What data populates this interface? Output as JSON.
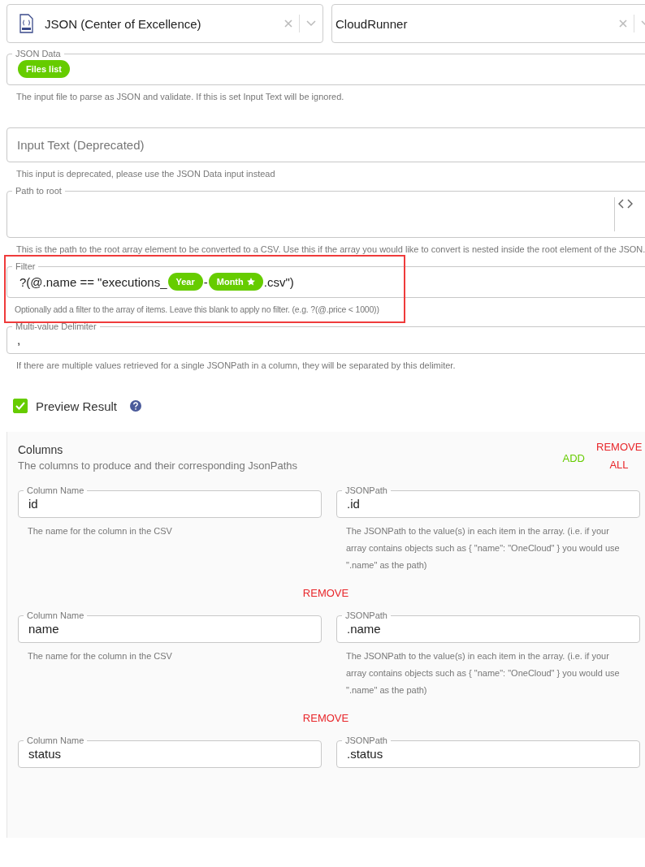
{
  "selects": [
    {
      "value": "JSON (Center of Excellence)"
    },
    {
      "value": "CloudRunner"
    }
  ],
  "fields": [
    {
      "kind": "chips",
      "label": "JSON Data",
      "chips": [
        "Files list"
      ],
      "helper": "The input file to parse as JSON and validate. If this is set Input Text will be ignored."
    },
    {
      "kind": "plain",
      "placeholder": "Input Text (Deprecated)",
      "helper": "This input is deprecated, please use the JSON Data input instead"
    },
    {
      "kind": "code",
      "label": "Path to root",
      "helper": "This is the path to the root array element to be converted to a CSV. Use this if the array you would like to convert is nested inside the root element of the JSON."
    },
    {
      "kind": "mixed",
      "label": "Filter",
      "highlighted": true,
      "parts": [
        {
          "kind": "text",
          "text": "?(@.name == \"executions_"
        },
        {
          "kind": "chip",
          "text": "Year"
        },
        {
          "kind": "text",
          "text": "-"
        },
        {
          "kind": "chip",
          "text": "Month",
          "starred": true
        },
        {
          "kind": "text",
          "text": ".csv\")"
        }
      ],
      "helper": "Optionally add a filter to the array of items. Leave this blank to apply no filter. (e.g. ?(@.price < 1000))"
    },
    {
      "kind": "value",
      "label": "Multi-value Delimiter",
      "value": ",",
      "helper": "If there are multiple values retrieved for a single JSONPath in a column, they will be separated by this delimiter."
    }
  ],
  "preview": {
    "label": "Preview Result",
    "checked": true
  },
  "columns": {
    "title": "Columns",
    "subtitle": "The columns to produce and their corresponding JsonPaths",
    "add": "ADD",
    "remove_all": "REMOVE ALL",
    "rows": [
      {
        "name_label": "Column Name",
        "name": "id",
        "name_helper": "The name for the column in the CSV",
        "path_label": "JSONPath",
        "path": ".id",
        "path_helper": "The JSONPath to the value(s) in each item in the array. (i.e. if your array contains objects such as { \"name\": \"OneCloud\" } you would use \".name\" as the path)",
        "remove": "REMOVE"
      },
      {
        "name_label": "Column Name",
        "name": "name",
        "name_helper": "The name for the column in the CSV",
        "path_label": "JSONPath",
        "path": ".name",
        "path_helper": "The JSONPath to the value(s) in each item in the array. (i.e. if your array contains objects such as { \"name\": \"OneCloud\" } you would use \".name\" as the path)",
        "remove": "REMOVE"
      },
      {
        "name_label": "Column Name",
        "name": "status",
        "path_label": "JSONPath",
        "path": ".status"
      }
    ]
  }
}
